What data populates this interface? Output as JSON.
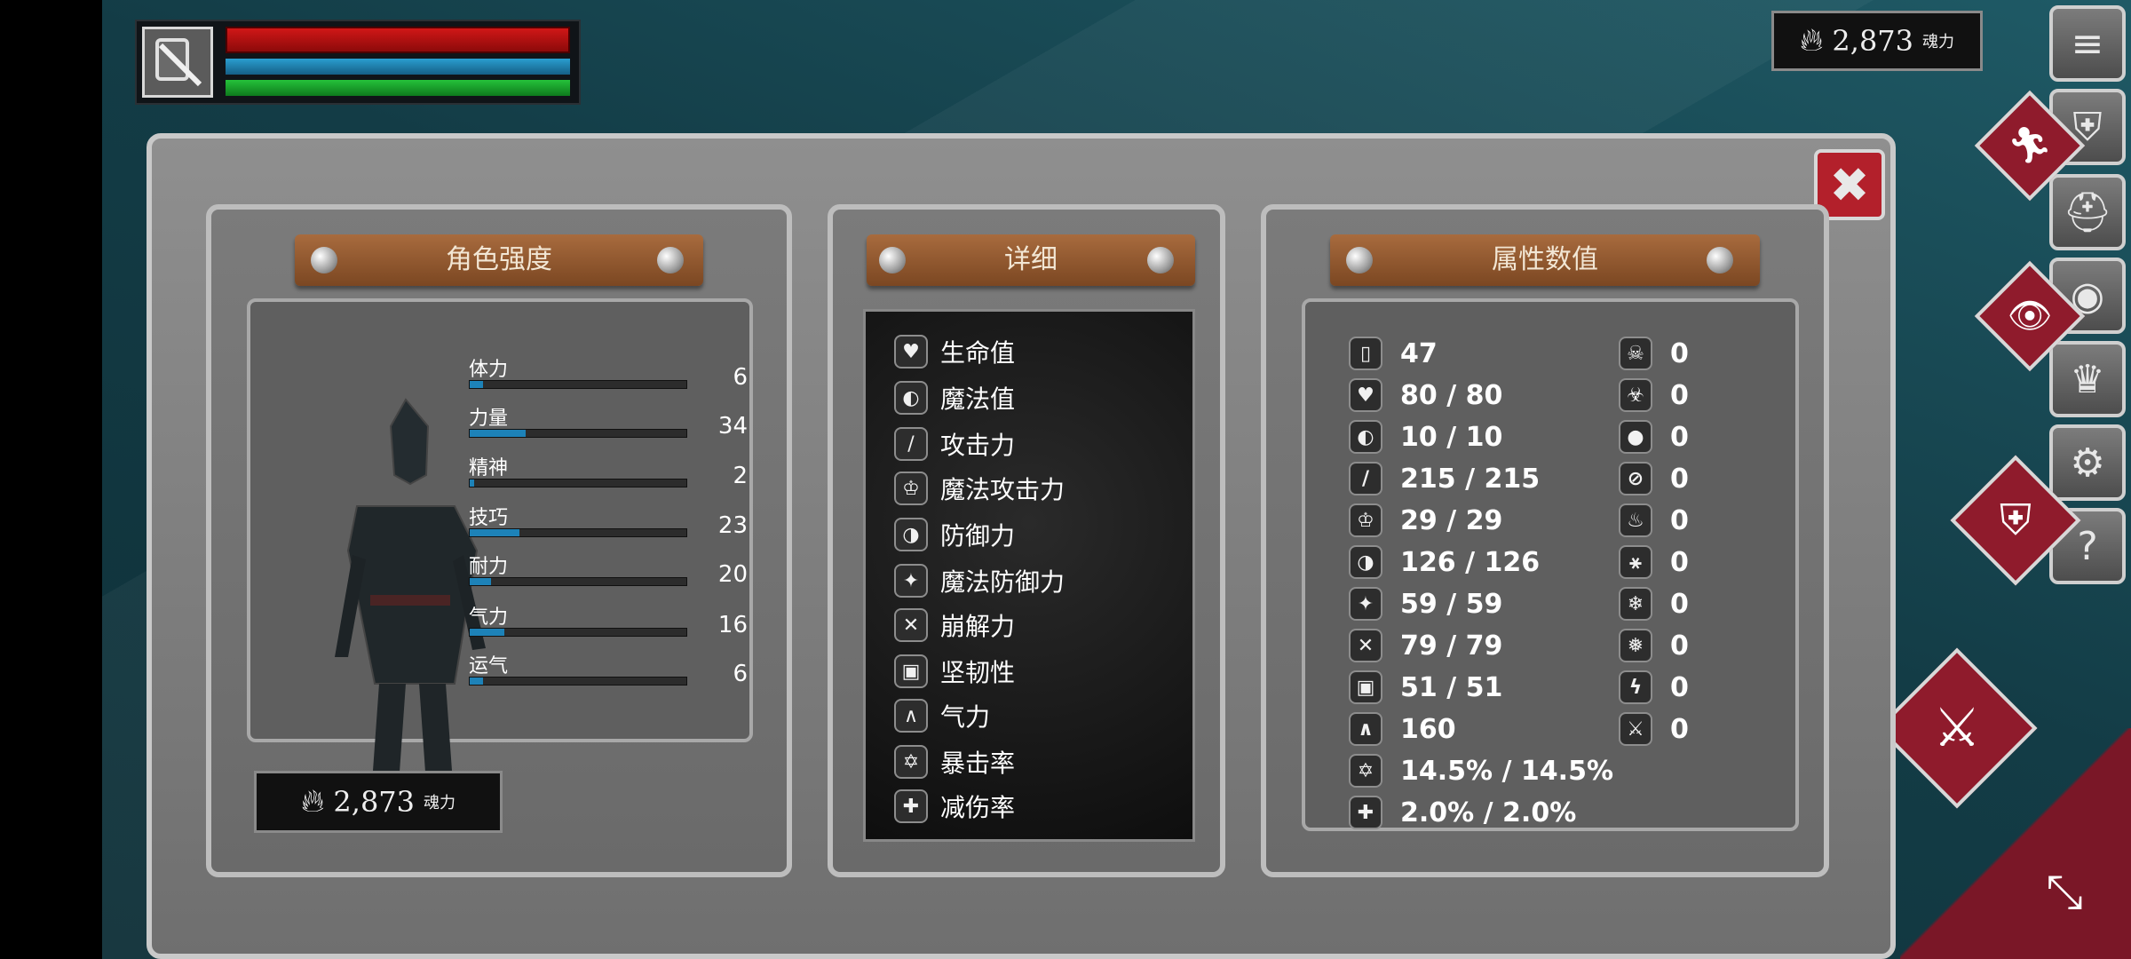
{
  "currency": {
    "amount": "2,873",
    "unit": "魂力"
  },
  "menu": {
    "list_icon": "≡",
    "armor_icon": "⛨",
    "helmet_icon": "⛑",
    "medallion_icon": "◉",
    "crown_icon": "♛",
    "gear_icon": "⚙",
    "help_icon": "?"
  },
  "panels": {
    "character_title": "角色强度",
    "detail_title": "详细",
    "attribute_title": "属性数值"
  },
  "stats": [
    {
      "label": "体力",
      "value": "6",
      "fill": 0.06
    },
    {
      "label": "力量",
      "value": "34",
      "fill": 0.26
    },
    {
      "label": "精神",
      "value": "2",
      "fill": 0.02
    },
    {
      "label": "技巧",
      "value": "23",
      "fill": 0.23
    },
    {
      "label": "耐力",
      "value": "20",
      "fill": 0.1
    },
    {
      "label": "气力",
      "value": "16",
      "fill": 0.16
    },
    {
      "label": "运气",
      "value": "6",
      "fill": 0.06
    }
  ],
  "details": [
    {
      "icon": "♥",
      "label": "生命值"
    },
    {
      "icon": "◐",
      "label": "魔法值"
    },
    {
      "icon": "/",
      "label": "攻击力"
    },
    {
      "icon": "♔",
      "label": "魔法攻击力"
    },
    {
      "icon": "◑",
      "label": "防御力"
    },
    {
      "icon": "✦",
      "label": "魔法防御力"
    },
    {
      "icon": "✕",
      "label": "崩解力"
    },
    {
      "icon": "▣",
      "label": "坚韧性"
    },
    {
      "icon": "∧",
      "label": "气力"
    },
    {
      "icon": "✡",
      "label": "暴击率"
    },
    {
      "icon": "✚",
      "label": "减伤率"
    }
  ],
  "attributes_left": [
    {
      "icon": "▯",
      "value": "47"
    },
    {
      "icon": "♥",
      "value": "80 / 80"
    },
    {
      "icon": "◐",
      "value": "10 / 10"
    },
    {
      "icon": "/",
      "value": "215 / 215"
    },
    {
      "icon": "♔",
      "value": "29 / 29"
    },
    {
      "icon": "◑",
      "value": "126 / 126"
    },
    {
      "icon": "✦",
      "value": "59 / 59"
    },
    {
      "icon": "✕",
      "value": "79 / 79"
    },
    {
      "icon": "▣",
      "value": "51 / 51"
    },
    {
      "icon": "∧",
      "value": "160"
    },
    {
      "icon": "✡",
      "value": "14.5% / 14.5%"
    },
    {
      "icon": "✚",
      "value": "2.0% / 2.0%"
    }
  ],
  "attributes_right": [
    {
      "icon": "☠",
      "value": "0"
    },
    {
      "icon": "☣",
      "value": "0"
    },
    {
      "icon": "●",
      "value": "0"
    },
    {
      "icon": "⊘",
      "value": "0"
    },
    {
      "icon": "♨",
      "value": "0"
    },
    {
      "icon": "⚹",
      "value": "0"
    },
    {
      "icon": "❄",
      "value": "0"
    },
    {
      "icon": "❅",
      "value": "0"
    },
    {
      "icon": "ϟ",
      "value": "0"
    },
    {
      "icon": "⚔",
      "value": "0"
    }
  ]
}
